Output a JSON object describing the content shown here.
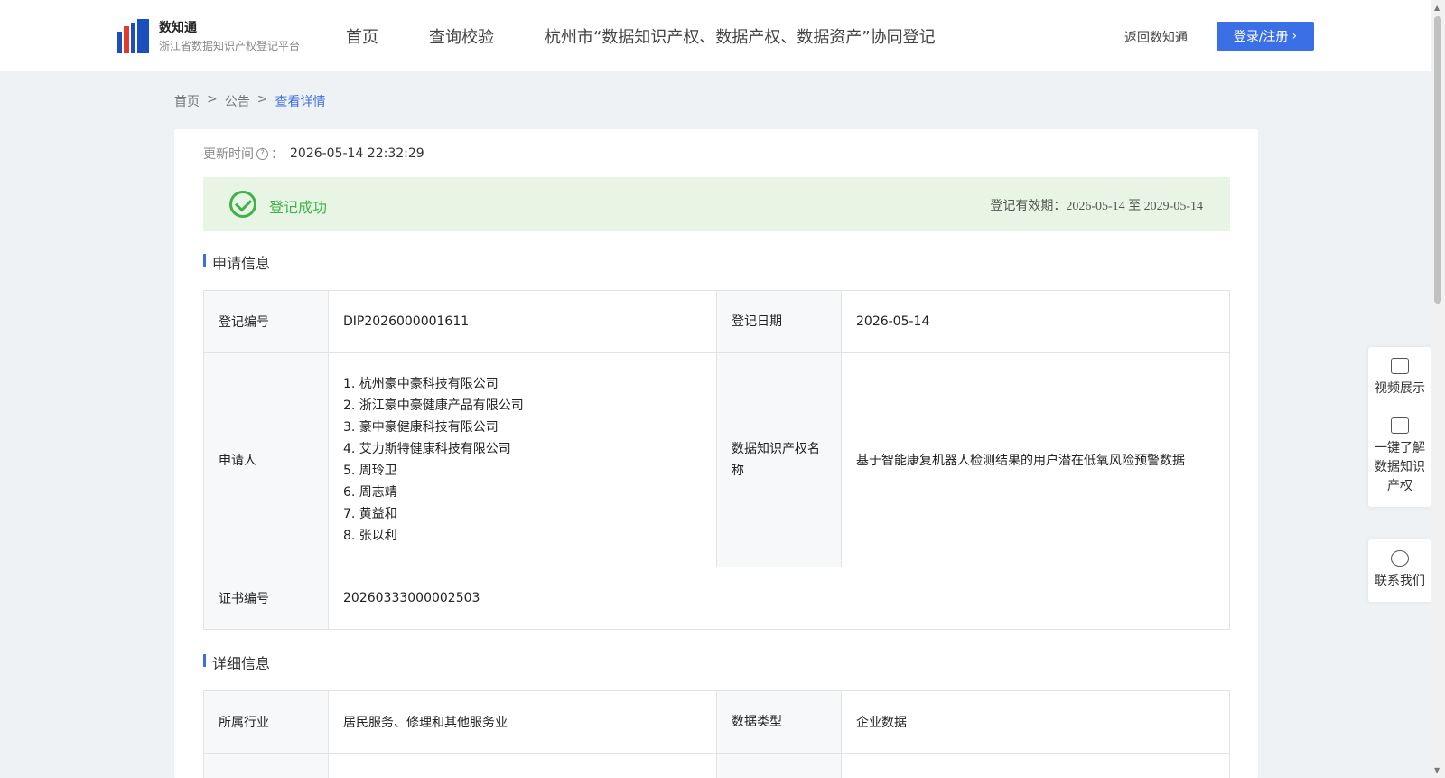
{
  "header": {
    "brand_name": "数知通",
    "brand_sub": "浙江省数据知识产权登记平台",
    "nav": [
      "首页",
      "查询校验",
      "杭州市“数据知识产权、数据产权、数据资产”协同登记"
    ],
    "back_link": "返回数知通",
    "login": "登录/注册"
  },
  "breadcrumb": {
    "home": "首页",
    "sep": ">",
    "notice": "公告",
    "current": "查看详情"
  },
  "update": {
    "label": "更新时间",
    "colon": "：",
    "value": "2026-05-14 22:32:29"
  },
  "status": {
    "text": "登记成功",
    "validity_label": "登记有效期：",
    "validity_value": "2026-05-14 至 2029-05-14",
    "color": "#3fb24a"
  },
  "apply_section": {
    "title": "申请信息",
    "reg_no_label": "登记编号",
    "reg_no": "DIP2026000001611",
    "reg_date_label": "登记日期",
    "reg_date": "2026-05-14",
    "applicant_label": "申请人",
    "applicants": [
      "1. 杭州豪中豪科技有限公司",
      "2. 浙江豪中豪健康产品有限公司",
      "3. 豪中豪健康科技有限公司",
      "4. 艾力斯特健康科技有限公司",
      "5. 周玲卫",
      "6. 周志靖",
      "7. 黄益和",
      "8. 张以利"
    ],
    "ip_name_label": "数据知识产权名称",
    "ip_name": "基于智能康复机器人检测结果的用户潜在低氧风险预警数据",
    "cert_label": "证书编号",
    "cert_no": "20260333000002503"
  },
  "detail_section": {
    "title": "详细信息",
    "industry_label": "所属行业",
    "industry": "居民服务、修理和其他服务业",
    "data_type_label": "数据类型",
    "data_type": "企业数据"
  },
  "side_panel": {
    "video": "视频展示",
    "learn": "一键了解数据知识产权",
    "contact": "联系我们"
  },
  "colors": {
    "accent": "#3a6fe6",
    "success": "#3fb24a",
    "success_bg": "#e9f5e4"
  }
}
